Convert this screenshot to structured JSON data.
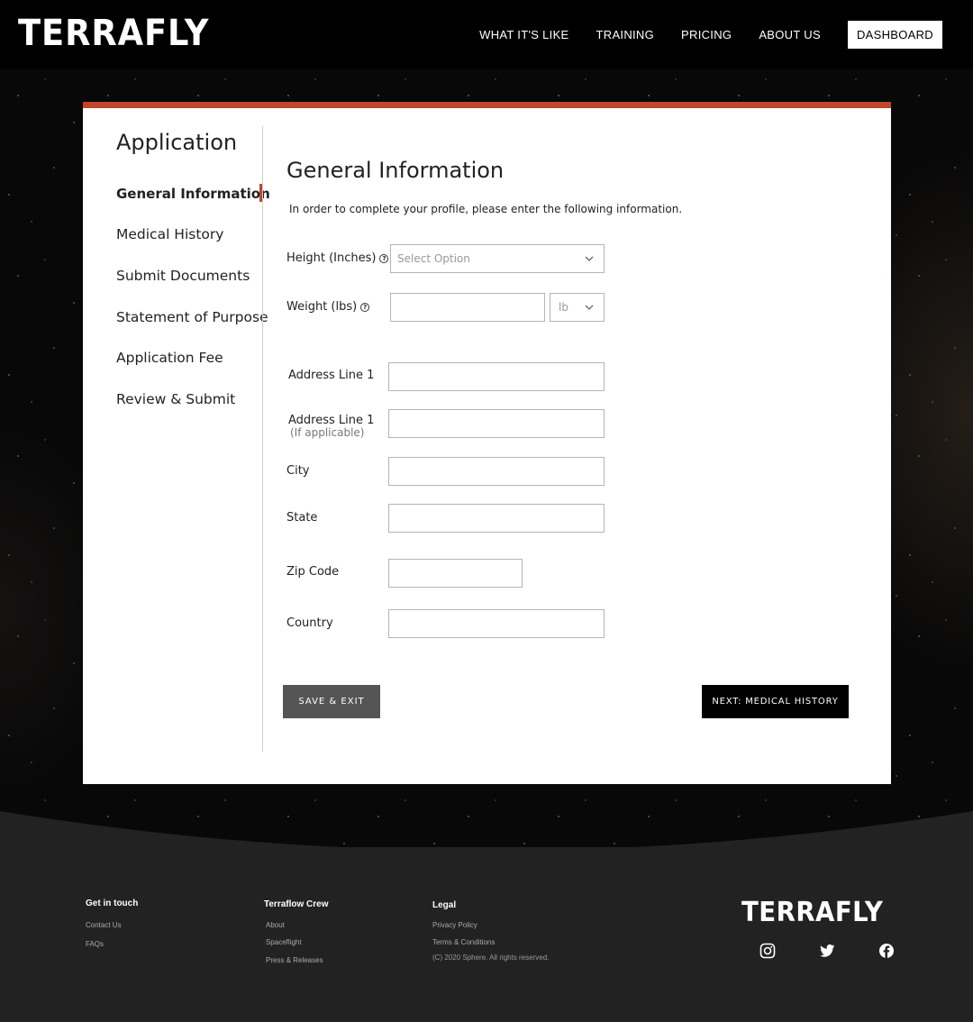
{
  "header": {
    "logo": "TERRAFLY",
    "nav": [
      "WHAT IT'S LIKE",
      "TRAINING",
      "PRICING",
      "ABOUT US"
    ],
    "dashboard_label": "DASHBOARD"
  },
  "sidebar": {
    "title": "Application",
    "items": [
      {
        "label": "General Information"
      },
      {
        "label": "Medical History"
      },
      {
        "label": "Submit Documents"
      },
      {
        "label": "Statement of Purpose"
      },
      {
        "label": "Application Fee"
      },
      {
        "label": "Review & Submit"
      }
    ]
  },
  "form": {
    "title": "General Information",
    "intro": "In order to complete your profile, please enter the following information.",
    "height_label": "Height (Inches)",
    "height_placeholder": "Select Option",
    "weight_label": "Weight (lbs)",
    "weight_unit": "lb",
    "address1_label": "Address Line 1",
    "address2_label": "Address Line 1",
    "address2_sublabel": "(If applicable)",
    "city_label": "City",
    "state_label": "State",
    "zip_label": "Zip Code",
    "country_label": "Country",
    "save_label": "SAVE & EXIT",
    "next_label": "NEXT: MEDICAL HISTORY"
  },
  "footer": {
    "col1": {
      "heading": "Get in touch",
      "links": [
        "Contact Us",
        "FAQs"
      ]
    },
    "col2": {
      "heading": "Terraflow Crew",
      "links": [
        "About",
        "Spaceflight",
        "Press & Releases"
      ]
    },
    "col3": {
      "heading": "Legal",
      "links": [
        "Privacy Policy",
        "Terms & Conditions"
      ],
      "copyright": "(C) 2020 Sphere. All rights reserved."
    },
    "logo": "TERRAFLY",
    "social_icons": [
      "instagram-icon",
      "twitter-icon",
      "facebook-icon"
    ]
  },
  "colors": {
    "accent": "#c0472a",
    "header_bg": "#000000",
    "footer_bg": "#222222"
  }
}
